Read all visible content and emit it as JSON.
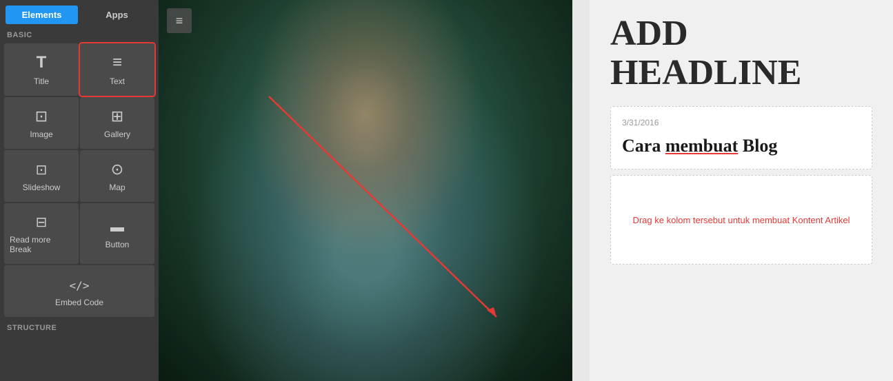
{
  "sidebar": {
    "tabs": [
      {
        "id": "elements",
        "label": "Elements",
        "active": true
      },
      {
        "id": "apps",
        "label": "Apps",
        "active": false
      }
    ],
    "basic_label": "BASIC",
    "structure_label": "STRUCTURE",
    "elements": [
      {
        "id": "title",
        "label": "Title",
        "icon": "icon-title",
        "highlighted": false
      },
      {
        "id": "text",
        "label": "Text",
        "icon": "icon-text",
        "highlighted": true
      },
      {
        "id": "image",
        "label": "Image",
        "icon": "icon-image",
        "highlighted": false
      },
      {
        "id": "gallery",
        "label": "Gallery",
        "icon": "icon-gallery",
        "highlighted": false
      },
      {
        "id": "slideshow",
        "label": "Slideshow",
        "icon": "icon-slideshow",
        "highlighted": false
      },
      {
        "id": "map",
        "label": "Map",
        "icon": "icon-map",
        "highlighted": false
      },
      {
        "id": "readmore",
        "label": "Read more Break",
        "icon": "icon-readmore",
        "highlighted": false
      },
      {
        "id": "button",
        "label": "Button",
        "icon": "icon-button",
        "highlighted": false
      },
      {
        "id": "embed",
        "label": "Embed Code",
        "icon": "icon-embed",
        "highlighted": false
      }
    ]
  },
  "toolbar": {
    "menu_icon": "≡"
  },
  "right_panel": {
    "headline": "ADD HEADLINE",
    "article": {
      "date": "3/31/2016",
      "title_part1": "Cara ",
      "title_underline": "membuat",
      "title_part2": " Blog"
    },
    "drop_hint": "Drag ke kolom tersebut untuk membuat Kontent Artikel"
  }
}
